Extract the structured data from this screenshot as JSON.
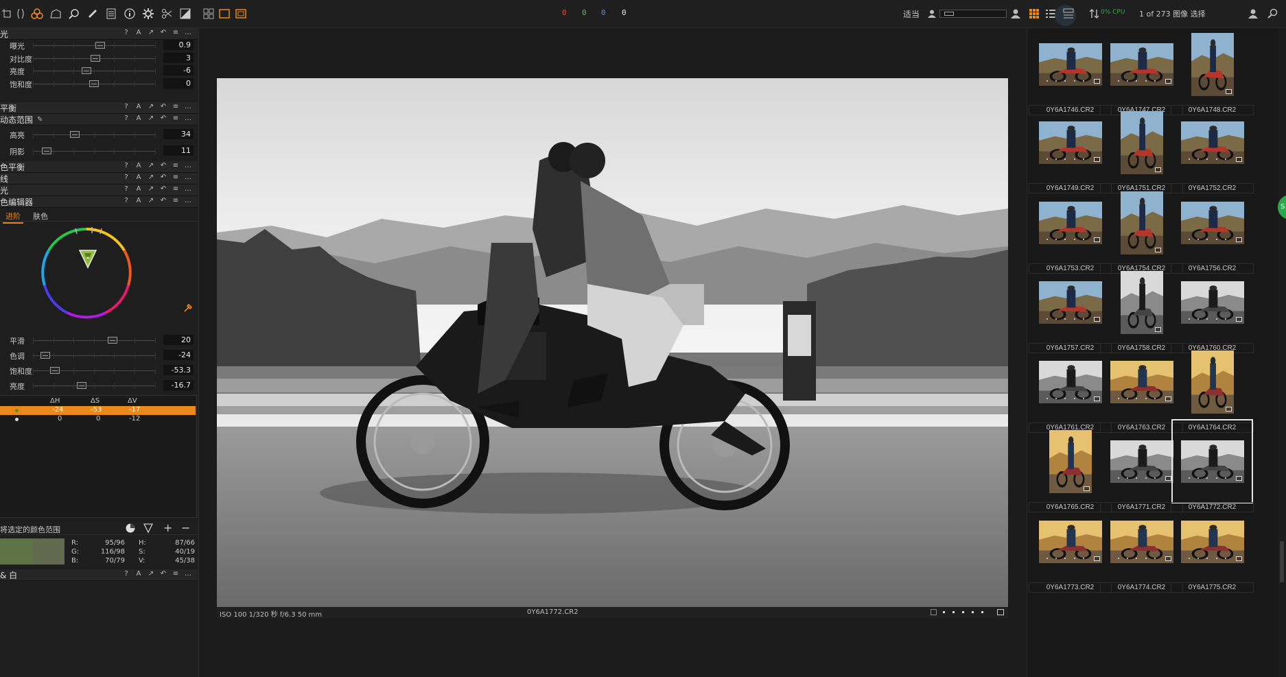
{
  "toolbar": {
    "icons": [
      "crop-icon",
      "lens-icon",
      "color-balance-icon",
      "perspective-icon",
      "zoom-icon",
      "brush-icon",
      "text-icon",
      "info-icon",
      "gear-icon",
      "tools-icon",
      "adjust-icon"
    ],
    "layout_icons": [
      "grid-view-icon",
      "single-view-icon",
      "compare-view-icon"
    ],
    "counters": [
      "0",
      "0",
      "0",
      "0"
    ],
    "counter_colors": [
      "#e64a3b",
      "#4cc24a",
      "#4a8ef0",
      "#e6e6e6"
    ],
    "fit_label": "适当",
    "count_label": "1 of 273 图像 选择",
    "overlay_label": "0% CPU"
  },
  "left_panel": {
    "exposure": {
      "title": "光",
      "sliders": [
        {
          "label": "曝光",
          "value": "0.9",
          "pos": 0.55
        },
        {
          "label": "对比度",
          "value": "3",
          "pos": 0.51
        },
        {
          "label": "亮度",
          "value": "-6",
          "pos": 0.44
        },
        {
          "label": "饱和度",
          "value": "0",
          "pos": 0.5
        }
      ]
    },
    "white_balance": {
      "title": "平衡"
    },
    "hdr": {
      "title": "动态范围",
      "sliders": [
        {
          "label": "高亮",
          "value": "34",
          "pos": 0.34
        },
        {
          "label": "阴影",
          "value": "11",
          "pos": 0.11
        }
      ]
    },
    "color_balance": {
      "title": "色平衡"
    },
    "curve": {
      "title": "线"
    },
    "clarity": {
      "title": "光"
    },
    "color_editor": {
      "title": "色编辑器",
      "tabs": [
        "进阶",
        "肤色"
      ],
      "sliders": [
        {
          "label": "平滑",
          "value": "20",
          "pos": 0.65
        },
        {
          "label": "色调",
          "value": "-24",
          "pos": 0.1
        },
        {
          "label": "饱和度",
          "value": "-53.3",
          "pos": 0.18
        },
        {
          "label": "亮度",
          "value": "-16.7",
          "pos": 0.4
        }
      ],
      "table": {
        "headers": [
          "ΔH",
          "ΔS",
          "ΔV"
        ],
        "rows": [
          {
            "values": [
              "-24",
              "-53",
              "-17"
            ],
            "selected": true
          },
          {
            "values": [
              "0",
              "0",
              "-12"
            ],
            "selected": false
          }
        ]
      },
      "range_label": "将选定的颜色范围",
      "readout": {
        "r_label": "R:",
        "r_value": "95/96",
        "g_label": "G:",
        "g_value": "116/98",
        "b_label": "B:",
        "b_value": "70/79",
        "h_label": "H:",
        "h_value": "87/66",
        "s_label": "S:",
        "s_value": "40/19",
        "v_label": "V:",
        "v_value": "45/38"
      },
      "swatch_colors": [
        "#5e7346",
        "#616a4f"
      ]
    },
    "bw": {
      "title": "& 白"
    },
    "section_icons": [
      "?",
      "A",
      "↗",
      "↶",
      "≡",
      "…"
    ]
  },
  "viewer": {
    "status_left": "ISO 100  1/320 秒  f/6.3  50 mm",
    "status_center": "0Y6A1772.CR2"
  },
  "browser": {
    "thumbnails": [
      {
        "name": "0Y6A1746.CR2",
        "style": "color",
        "orient": "land"
      },
      {
        "name": "0Y6A1747.CR2",
        "style": "color",
        "orient": "land"
      },
      {
        "name": "0Y6A1748.CR2",
        "style": "color",
        "orient": "port"
      },
      {
        "name": "0Y6A1749.CR2",
        "style": "color",
        "orient": "land"
      },
      {
        "name": "0Y6A1751.CR2",
        "style": "color",
        "orient": "port"
      },
      {
        "name": "0Y6A1752.CR2",
        "style": "color",
        "orient": "land"
      },
      {
        "name": "0Y6A1753.CR2",
        "style": "color",
        "orient": "land"
      },
      {
        "name": "0Y6A1754.CR2",
        "style": "color",
        "orient": "port"
      },
      {
        "name": "0Y6A1756.CR2",
        "style": "color",
        "orient": "land"
      },
      {
        "name": "0Y6A1757.CR2",
        "style": "color",
        "orient": "land"
      },
      {
        "name": "0Y6A1758.CR2",
        "style": "bw",
        "orient": "port"
      },
      {
        "name": "0Y6A1760.CR2",
        "style": "bw",
        "orient": "land"
      },
      {
        "name": "0Y6A1761.CR2",
        "style": "bw",
        "orient": "land"
      },
      {
        "name": "0Y6A1763.CR2",
        "style": "warm",
        "orient": "land"
      },
      {
        "name": "0Y6A1764.CR2",
        "style": "warm",
        "orient": "port"
      },
      {
        "name": "0Y6A1765.CR2",
        "style": "warm",
        "orient": "port"
      },
      {
        "name": "0Y6A1771.CR2",
        "style": "bw",
        "orient": "land"
      },
      {
        "name": "0Y6A1772.CR2",
        "style": "bw",
        "orient": "land",
        "selected": true
      },
      {
        "name": "0Y6A1773.CR2",
        "style": "warm",
        "orient": "land"
      },
      {
        "name": "0Y6A1774.CR2",
        "style": "warm",
        "orient": "land"
      },
      {
        "name": "0Y6A1775.CR2",
        "style": "warm",
        "orient": "land"
      }
    ]
  },
  "colors": {
    "accent": "#e8891a"
  }
}
